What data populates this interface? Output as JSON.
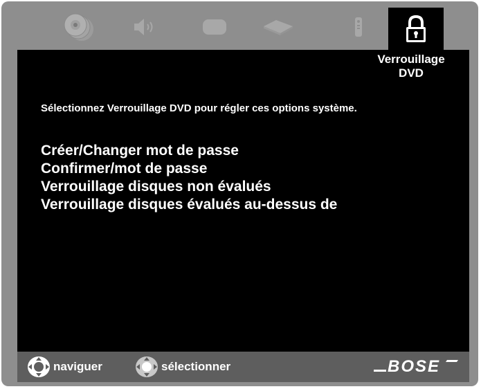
{
  "menu_tab": {
    "active_label_line1": "Verrouillage",
    "active_label_line2": "DVD",
    "icons": [
      "disc-stack-icon",
      "speaker-icon",
      "tv-screen-icon",
      "dvd-player-icon",
      "remote-icon",
      "padlock-icon"
    ]
  },
  "screen": {
    "instruction": "Sélectionnez Verrouillage DVD pour régler ces options système.",
    "options": [
      "Créer/Changer mot de passe",
      "Confirmer/mot de passe",
      "Verrouillage disques non évalués",
      "Verrouillage disques évalués au-dessus de"
    ]
  },
  "footer": {
    "navigate_label": "naviguer",
    "select_label": "sélectionner",
    "brand": "BOSE"
  },
  "colors": {
    "frame": "#8e8e8e",
    "screen": "#000000",
    "footer": "#5e5e5e",
    "text": "#ffffff",
    "inactive_icon": "#a8a8a8"
  }
}
